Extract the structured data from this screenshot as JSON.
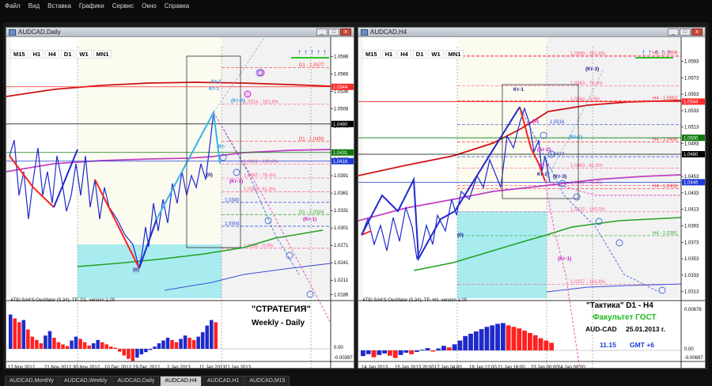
{
  "menu": [
    "Файл",
    "Вид",
    "Вставка",
    "Графики",
    "Сервис",
    "Окно",
    "Справка"
  ],
  "left_chart": {
    "title": "AUDCAD,Daily",
    "timeframes": [
      "M15",
      "H1",
      "H4",
      "D1",
      "W1",
      "MN1"
    ],
    "price_labels": [
      {
        "text": "1.0596",
        "price": 1.0596
      },
      {
        "text": "1.0566",
        "price": 1.0566
      },
      {
        "text": "1.0536",
        "price": 1.0536
      },
      {
        "text": "1.0506",
        "price": 1.0506
      },
      {
        "text": "1.0476",
        "price": 1.0476
      },
      {
        "text": "1.0420",
        "price": 1.042
      },
      {
        "text": "1.0391",
        "price": 1.0391
      },
      {
        "text": "1.0361",
        "price": 1.0361
      },
      {
        "text": "1.0331",
        "price": 1.0331
      },
      {
        "text": "1.0301",
        "price": 1.0301
      },
      {
        "text": "1.0271",
        "price": 1.0271
      },
      {
        "text": "1.0241",
        "price": 1.0241
      },
      {
        "text": "1.0211",
        "price": 1.0211
      },
      {
        "text": "1.0186",
        "price": 1.0186
      }
    ],
    "price_tags": [
      {
        "text": "1.0544",
        "price": 1.0544,
        "color": "#ff2a2a"
      },
      {
        "text": "1.0480",
        "price": 1.048,
        "color": "#000000"
      },
      {
        "text": "1.0431",
        "price": 1.0431,
        "color": "#0e7a0e"
      },
      {
        "text": "1.0416",
        "price": 1.0416,
        "color": "#1f3ad8"
      }
    ],
    "level_texts": [
      {
        "text": "D1 - 1.0577",
        "price": 1.0577,
        "color": "#ff3030"
      },
      {
        "text": "D1 - 1.0450",
        "price": 1.045,
        "color": "#ff3030"
      },
      {
        "text": "D1 - 1.0324",
        "price": 1.0324,
        "color": "#2aa82a"
      },
      {
        "text": "1.0345",
        "price": 1.0345,
        "color": "#2a4ad8"
      },
      {
        "text": "1.0304",
        "price": 1.0304,
        "color": "#2a4ad8"
      },
      {
        "text": "1.0514 - 161.8%",
        "price": 1.0514,
        "color": "#ff5a8a"
      },
      {
        "text": "1.0411 - 100.0%",
        "price": 1.0411,
        "color": "#ff5a8a"
      },
      {
        "text": "1.0387 - 76.4%",
        "price": 1.0387,
        "color": "#ff5a8a"
      },
      {
        "text": "1.0363 - 61.8%",
        "price": 1.0363,
        "color": "#ff5a8a"
      },
      {
        "text": "1.0266 - 0.0%",
        "price": 1.0266,
        "color": "#ff5a8a"
      }
    ],
    "wave_labels": [
      {
        "text": "Кт-1",
        "color": "#2e9ae6"
      },
      {
        "text": "Кт-1",
        "color": "#2e9ae6"
      },
      {
        "text": "(Кт-3)",
        "color": "#2e9ae6"
      },
      {
        "text": "(0)",
        "color": "#1a1a8a"
      },
      {
        "text": "(Кт-1)",
        "color": "#c21ec2"
      },
      {
        "text": "(Кт-1)",
        "color": "#c21ec2"
      },
      {
        "text": "(0)",
        "color": "#1a1a8a"
      },
      {
        "text": "Кт-",
        "color": "#2e9ae6"
      }
    ],
    "date_labels": [
      "12 Nov 2012",
      "21 Nov 2012",
      "30 Nov 2012",
      "10 Dec 2012",
      "19 Dec 2012",
      "2 Jan 2013",
      "11 Jan 2013",
      "21 Jan 2013"
    ],
    "oscillator": {
      "title": "ATEI.SAKS.Oscillator (5,34). TF: D1. version 1.00",
      "scale": [
        "0.00",
        "-0.00397"
      ],
      "values": [
        0.62,
        0.55,
        0.48,
        0.52,
        0.35,
        0.22,
        0.16,
        0.1,
        0.24,
        0.32,
        0.2,
        0.12,
        0.08,
        0.05,
        0.15,
        0.22,
        0.18,
        0.12,
        0.06,
        0.1,
        0.16,
        0.12,
        0.08,
        0.04,
        0.02,
        -0.05,
        -0.12,
        -0.18,
        -0.22,
        -0.16,
        -0.1,
        -0.06,
        -0.02,
        0.04,
        0.1,
        0.15,
        0.2,
        0.16,
        0.12,
        0.18,
        0.24,
        0.2,
        0.16,
        0.22,
        0.3,
        0.42,
        0.52,
        0.48
      ]
    },
    "strategy_title": "\"СТРАТЕГИЯ\"",
    "strategy_subtitle": "Weekly - Daily"
  },
  "right_chart": {
    "title": "AUDCAD,H4",
    "timeframes": [
      "M15",
      "H1",
      "H4",
      "D1",
      "W1",
      "MN1"
    ],
    "price_labels": [
      {
        "text": "1.0593",
        "price": 1.0593
      },
      {
        "text": "1.0573",
        "price": 1.0573
      },
      {
        "text": "1.0553",
        "price": 1.0553
      },
      {
        "text": "1.0533",
        "price": 1.0533
      },
      {
        "text": "1.0513",
        "price": 1.0513
      },
      {
        "text": "1.0493",
        "price": 1.0493
      },
      {
        "text": "1.0453",
        "price": 1.0453
      },
      {
        "text": "1.0433",
        "price": 1.0433
      },
      {
        "text": "1.0413",
        "price": 1.0413
      },
      {
        "text": "1.0393",
        "price": 1.0393
      },
      {
        "text": "1.0373",
        "price": 1.0373
      },
      {
        "text": "1.0353",
        "price": 1.0353
      },
      {
        "text": "1.0333",
        "price": 1.0333
      },
      {
        "text": "1.0313",
        "price": 1.0313
      }
    ],
    "price_tags": [
      {
        "text": "1.0544",
        "price": 1.0544,
        "color": "#ff2a2a"
      },
      {
        "text": "1.0500",
        "price": 1.05,
        "color": "#0e7a0e"
      },
      {
        "text": "1.0480",
        "price": 1.048,
        "color": "#000000"
      },
      {
        "text": "1.0446",
        "price": 1.0446,
        "color": "#1f3ad8"
      }
    ],
    "level_texts": [
      {
        "text": "H4 - 1.0609",
        "price": 1.06,
        "color": "#ff3030"
      },
      {
        "text": "H4 - 1.0552",
        "price": 1.0545,
        "color": "#ff3030"
      },
      {
        "text": "H4 - 1.0495",
        "price": 1.0495,
        "color": "#ff3030"
      },
      {
        "text": "H4 - 1.0438",
        "price": 1.0438,
        "color": "#ff3030"
      },
      {
        "text": "H4 - 1.0381",
        "price": 1.0381,
        "color": "#2aa82a"
      },
      {
        "text": "1.0599 - 261.8%",
        "price": 1.0599,
        "color": "#ff5a8a"
      },
      {
        "text": "1.0563 - 76.4%",
        "price": 1.0563,
        "color": "#ff5a8a"
      },
      {
        "text": "1.0544 - 0.0%",
        "price": 1.0544,
        "color": "#ff5a8a"
      },
      {
        "text": "1.0463 - 61.8%",
        "price": 1.0463,
        "color": "#ff5a8a"
      },
      {
        "text": "1.0442 - 76.4%",
        "price": 1.0442,
        "color": "#ff5a8a"
      },
      {
        "text": "1.0410 - 100.0%",
        "price": 1.041,
        "color": "#ff5a8a"
      },
      {
        "text": "1.0327 - 161.8%",
        "price": 1.0322,
        "color": "#ff5a8a"
      },
      {
        "text": "1.0477",
        "price": 1.0477,
        "color": "#2a4ad8"
      },
      {
        "text": "1.0516",
        "price": 1.0516,
        "color": "#2a4ad8"
      }
    ],
    "wave_labels": [
      {
        "text": "Кт-1",
        "color": "#1a1a8a"
      },
      {
        "text": "(Кт-3)",
        "color": "#1a1a8a"
      },
      {
        "text": "(0)",
        "color": "#c21ec2"
      },
      {
        "text": "(Кт-2)",
        "color": "#c21ec2"
      },
      {
        "text": "(Кт-1)",
        "color": "#2e9ae6"
      },
      {
        "text": "Кт-1",
        "color": "#c21ec2"
      },
      {
        "text": "Кт-2",
        "color": "#1a1a8a"
      },
      {
        "text": "(Кт-3)",
        "color": "#1a1a8a"
      },
      {
        "text": "(0)",
        "color": "#1a1a8a"
      },
      {
        "text": "(Кт-1)",
        "color": "#c21ec2"
      }
    ],
    "date_labels": [
      "14 Jan 2013",
      "15 Jan 2013 20:00",
      "17 Jan 04:00",
      "18 Jan 12:00",
      "21 Jan 16:00",
      "23 Jan 00:00",
      "24 Jan 08:00"
    ],
    "oscillator": {
      "title": "ATEI.SAKS.Oscillator (5,34). TF: H4. version 1.00",
      "scale": [
        "0.00676",
        "0.00",
        "-0.00697"
      ],
      "values": [
        -0.15,
        -0.1,
        -0.18,
        -0.12,
        -0.08,
        -0.14,
        -0.2,
        -0.12,
        -0.06,
        -0.1,
        -0.04,
        0.02,
        0.06,
        -0.03,
        0.05,
        0.12,
        0.08,
        0.16,
        0.26,
        0.38,
        0.44,
        0.5,
        0.56,
        0.62,
        0.66,
        0.7,
        0.72,
        0.66,
        0.62,
        0.58,
        0.52,
        0.46,
        0.4,
        0.32,
        0.26,
        0.2
      ]
    },
    "tactic_title": "\"Тактика\"  D1 - H4",
    "tactic_school": "Факультет ГОСТ",
    "tactic_pair": "AUD-CAD",
    "tactic_date": "25.01.2013  г.",
    "tactic_time": "11.15",
    "tactic_gmt": "GMT +6"
  },
  "taskbar": {
    "tabs": [
      "AUDCAD,Monthly",
      "AUDCAD,Weekly",
      "AUDCAD,Daily",
      "AUDCAD,H4",
      "AUDCAD,H1",
      "AUDCAD,M15"
    ],
    "active": "AUDCAD,H4"
  },
  "colors": {
    "candle_up": "#1f2acb",
    "candle_down": "#ff2020",
    "ma_red": "#d01010",
    "ma_magenta": "#c040c0",
    "ma_green": "#20a020",
    "highlight_cyan": "#a9ecf0",
    "highlight_cream": "#fbfbf0"
  }
}
